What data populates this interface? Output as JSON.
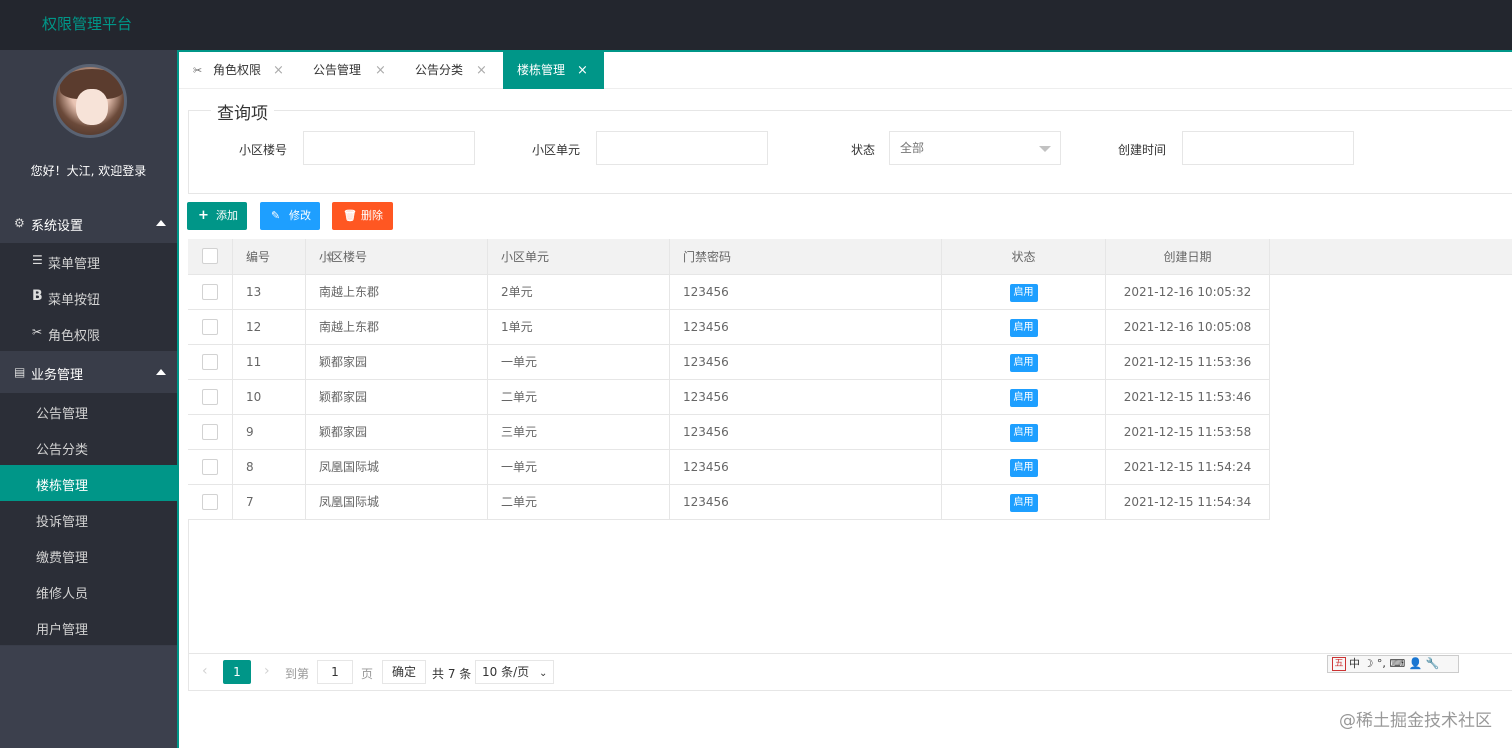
{
  "app": {
    "title": "权限管理平台"
  },
  "sidebar": {
    "welcome": "您好！大江, 欢迎登录",
    "groups": [
      {
        "label": "系统设置",
        "icon": "gear-icon",
        "items": [
          {
            "label": "菜单管理",
            "icon": "list-icon"
          },
          {
            "label": "菜单按钮",
            "icon": "bold-b-icon"
          },
          {
            "label": "角色权限",
            "icon": "tools-icon"
          }
        ]
      },
      {
        "label": "业务管理",
        "icon": "clipboard-icon",
        "items": [
          {
            "label": "公告管理"
          },
          {
            "label": "公告分类"
          },
          {
            "label": "楼栋管理",
            "active": true
          },
          {
            "label": "投诉管理"
          },
          {
            "label": "缴费管理"
          },
          {
            "label": "维修人员"
          },
          {
            "label": "用户管理"
          }
        ]
      }
    ]
  },
  "tabs": [
    {
      "label": "角色权限",
      "icon": "tools-icon"
    },
    {
      "label": "公告管理"
    },
    {
      "label": "公告分类"
    },
    {
      "label": "楼栋管理",
      "active": true
    }
  ],
  "tab_close_glyph": "×",
  "query": {
    "legend": "查询项",
    "building_label": "小区楼号",
    "unit_label": "小区单元",
    "status_label": "状态",
    "status_value": "全部",
    "created_label": "创建时间"
  },
  "actions": {
    "add_label": "添加",
    "edit_label": "修改",
    "delete_label": "删除"
  },
  "table": {
    "headers": [
      "编号",
      "小区楼号",
      "小区单元",
      "门禁密码",
      "状态",
      "创建日期"
    ],
    "rows": [
      {
        "id": "13",
        "building": "南越上东郡",
        "unit": "2单元",
        "password": "123456",
        "status": "启用",
        "created": "2021-12-16 10:05:32"
      },
      {
        "id": "12",
        "building": "南越上东郡",
        "unit": "1单元",
        "password": "123456",
        "status": "启用",
        "created": "2021-12-16 10:05:08"
      },
      {
        "id": "11",
        "building": "颖都家园",
        "unit": "一单元",
        "password": "123456",
        "status": "启用",
        "created": "2021-12-15 11:53:36"
      },
      {
        "id": "10",
        "building": "颖都家园",
        "unit": "二单元",
        "password": "123456",
        "status": "启用",
        "created": "2021-12-15 11:53:46"
      },
      {
        "id": "9",
        "building": "颖都家园",
        "unit": "三单元",
        "password": "123456",
        "status": "启用",
        "created": "2021-12-15 11:53:58"
      },
      {
        "id": "8",
        "building": "凤凰国际城",
        "unit": "一单元",
        "password": "123456",
        "status": "启用",
        "created": "2021-12-15 11:54:24"
      },
      {
        "id": "7",
        "building": "凤凰国际城",
        "unit": "二单元",
        "password": "123456",
        "status": "启用",
        "created": "2021-12-15 11:54:34"
      }
    ]
  },
  "pager": {
    "current_page": "1",
    "goto_label": "到第",
    "goto_value": "1",
    "page_suffix": "页",
    "confirm_label": "确定",
    "total_text": "共 7 条",
    "page_size": "10 条/页"
  },
  "ime": {
    "text": "中 ☽ °, ⌨ 👤 🔧",
    "logo": "五"
  },
  "watermark": "@稀土掘金技术社区",
  "colors": {
    "header_bg": "#23262e",
    "sidebar_bg": "#393d49",
    "accent": "#009688",
    "edit_btn": "#1e9fff",
    "delete_btn": "#ff5722",
    "status_badge": "#1e9fff"
  }
}
